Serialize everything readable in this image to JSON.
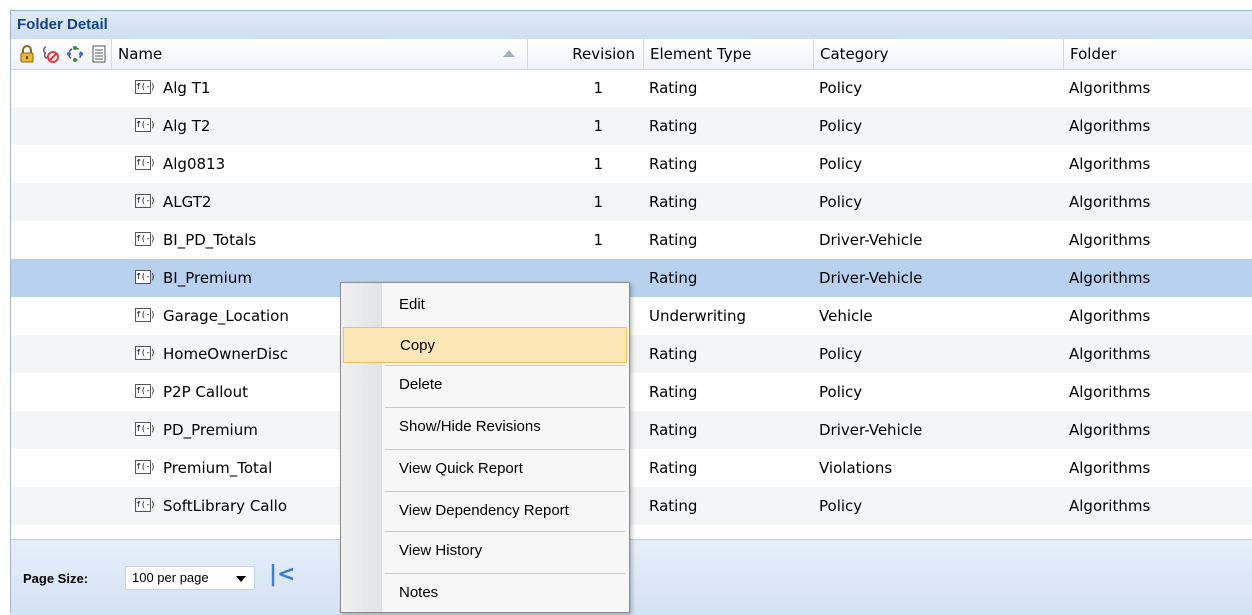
{
  "panel": {
    "title": "Folder Detail"
  },
  "header": {
    "icons": [
      "lock-icon",
      "checkout-icon",
      "refresh-icon",
      "details-icon"
    ],
    "columns": {
      "name": "Name",
      "revision": "Revision",
      "element_type": "Element Type",
      "category": "Category",
      "folder": "Folder"
    }
  },
  "rows": [
    {
      "name": "Alg T1",
      "revision": "1",
      "element_type": "Rating",
      "category": "Policy",
      "folder": "Algorithms"
    },
    {
      "name": "Alg T2",
      "revision": "1",
      "element_type": "Rating",
      "category": "Policy",
      "folder": "Algorithms"
    },
    {
      "name": "Alg0813",
      "revision": "1",
      "element_type": "Rating",
      "category": "Policy",
      "folder": "Algorithms"
    },
    {
      "name": "ALGT2",
      "revision": "1",
      "element_type": "Rating",
      "category": "Policy",
      "folder": "Algorithms"
    },
    {
      "name": "BI_PD_Totals",
      "revision": "1",
      "element_type": "Rating",
      "category": "Driver-Vehicle",
      "folder": "Algorithms"
    },
    {
      "name": "BI_Premium",
      "revision": "",
      "element_type": "Rating",
      "category": "Driver-Vehicle",
      "folder": "Algorithms",
      "selected": true
    },
    {
      "name": "Garage_Location",
      "revision": "",
      "element_type": "Underwriting",
      "category": "Vehicle",
      "folder": "Algorithms"
    },
    {
      "name": "HomeOwnerDisc",
      "revision": "",
      "element_type": "Rating",
      "category": "Policy",
      "folder": "Algorithms"
    },
    {
      "name": "P2P Callout",
      "revision": "",
      "element_type": "Rating",
      "category": "Policy",
      "folder": "Algorithms"
    },
    {
      "name": "PD_Premium",
      "revision": "",
      "element_type": "Rating",
      "category": "Driver-Vehicle",
      "folder": "Algorithms"
    },
    {
      "name": "Premium_Total",
      "revision": "",
      "element_type": "Rating",
      "category": "Violations",
      "folder": "Algorithms"
    },
    {
      "name": "SoftLibrary Callo",
      "revision": "",
      "element_type": "Rating",
      "category": "Policy",
      "folder": "Algorithms"
    }
  ],
  "row_icon": {
    "name": "function-icon",
    "glyph": "f(-)"
  },
  "pager": {
    "label": "Page Size:",
    "page_size": "100 per page",
    "first_page_glyph": "|<"
  },
  "context_menu": {
    "items": [
      {
        "label": "Edit"
      },
      {
        "label": "Copy",
        "highlighted": true
      },
      {
        "label": "Delete"
      },
      {
        "label": "Show/Hide Revisions"
      },
      {
        "label": "View Quick Report"
      },
      {
        "label": "View Dependency Report"
      },
      {
        "label": "View History"
      },
      {
        "label": "Notes"
      }
    ]
  },
  "colors": {
    "title_text": "#15428b",
    "selected_row": "#b7d1ef",
    "menu_highlight": "#fde7b5",
    "lock_icon": "#e8a317",
    "no_icon": "#e23b3b"
  }
}
